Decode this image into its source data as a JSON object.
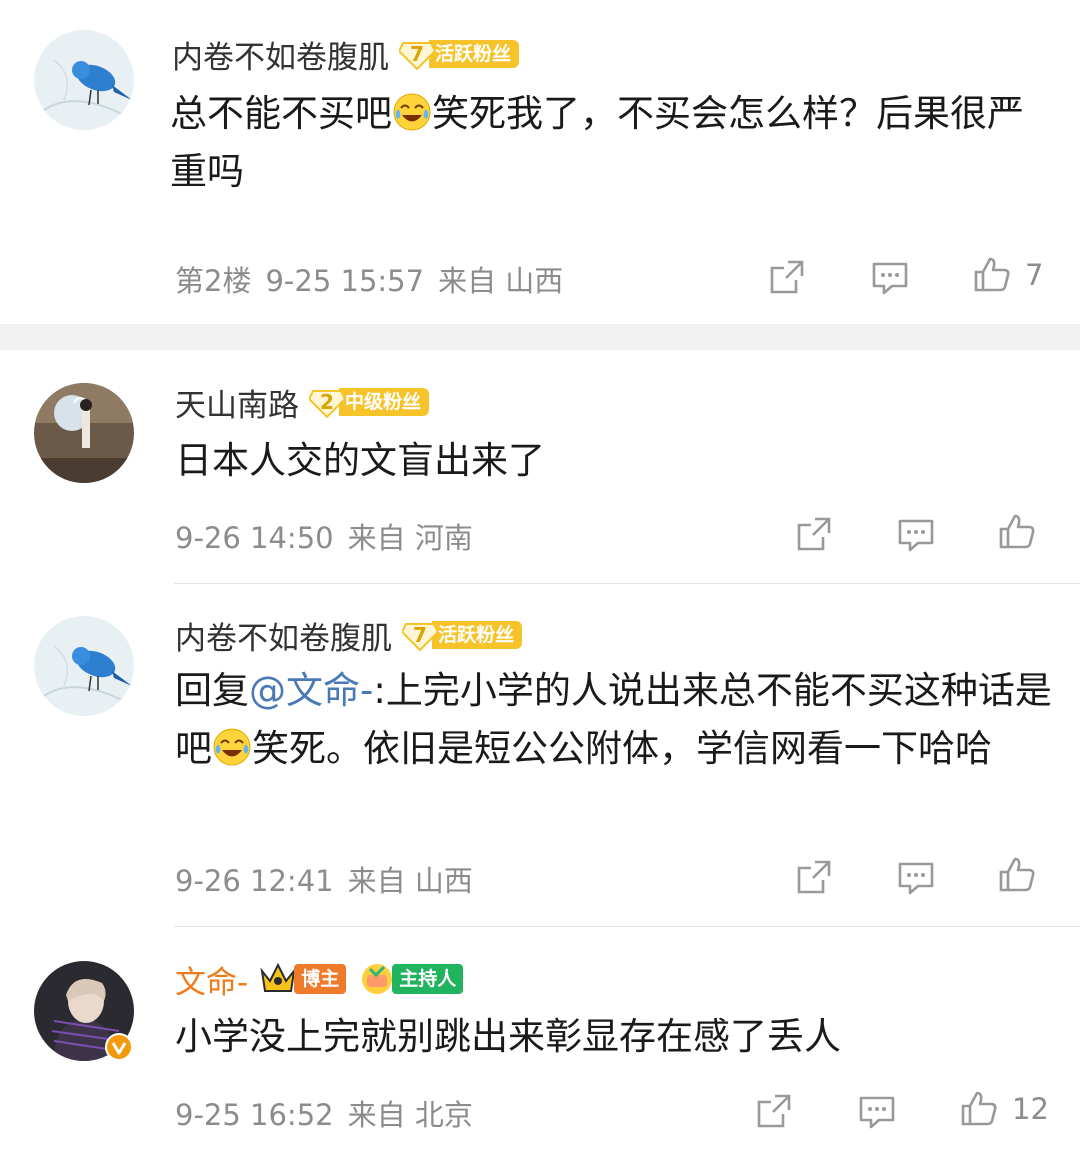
{
  "comments": [
    {
      "username": "内卷不如卷腹肌",
      "badge_level": "7",
      "badge_text": "活跃粉丝",
      "text_a": "总不能不买吧",
      "text_b": "笑死我了，不买会怎么样？后果很严重吗",
      "floor": "第2楼",
      "time": "9-25 15:57",
      "from": "来自 山西",
      "likes": "7"
    },
    {
      "username": "天山南路",
      "badge_level": "2",
      "badge_text": "中级粉丝",
      "text": "日本人交的文盲出来了",
      "time": "9-26 14:50",
      "from": "来自 河南"
    },
    {
      "username": "内卷不如卷腹肌",
      "badge_level": "7",
      "badge_text": "活跃粉丝",
      "reply_prefix": "回复",
      "mention": "@文命-",
      "text_a": ":上完小学的人说出来总不能不买这种话是吧",
      "text_b": "笑死。依旧是短公公附体，学信网看一下哈哈",
      "time": "9-26 12:41",
      "from": "来自 山西"
    },
    {
      "username": "文命-",
      "tag1": "博主",
      "tag2": "主持人",
      "text": "小学没上完就别跳出来彰显存在感了丢人",
      "time": "9-25 16:52",
      "from": "来自 北京",
      "likes": "12"
    }
  ],
  "icons": {
    "share": "share-icon",
    "comment": "comment-icon",
    "like": "thumbs-up-icon",
    "emoji": "laugh-cry-emoji-icon"
  },
  "colors": {
    "accent_orange": "#ee7b1b",
    "badge_yellow": "#f6c32b",
    "mention_blue": "#4a7ab5",
    "meta_gray": "#8c8c8c"
  }
}
